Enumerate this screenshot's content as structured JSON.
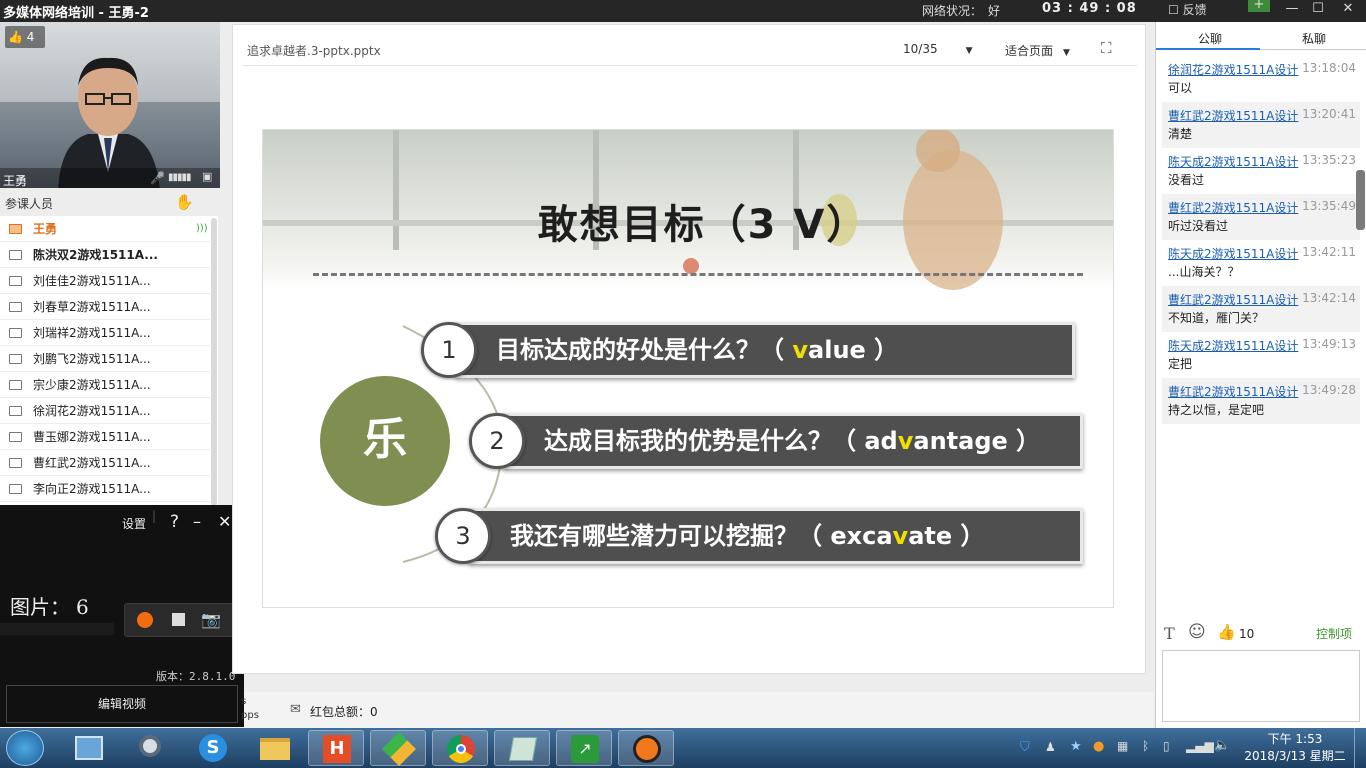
{
  "window": {
    "title": "多媒体网络培训 - 王勇-2",
    "network_label": "网络状况：",
    "network_value": "好",
    "clock": "03 : 49 : 08",
    "feedback": "反馈"
  },
  "video": {
    "likes": "4",
    "presenter": "王勇"
  },
  "roster": {
    "title": "参课人员",
    "items": [
      "王勇",
      "陈洪双2游戏1511A...",
      "刘佳佳2游戏1511A...",
      "刘春草2游戏1511A...",
      "刘瑞祥2游戏1511A...",
      "刘鹏飞2游戏1511A...",
      "宗少康2游戏1511A...",
      "徐润花2游戏1511A...",
      "曹玉娜2游戏1511A...",
      "曹红武2游戏1511A...",
      "李向正2游戏1511A..."
    ]
  },
  "recorder": {
    "settings": "设置",
    "help": "?",
    "minimize": "–",
    "close": "✕",
    "pic_label": "图片：",
    "pic_count": "6",
    "version": "版本：2.8.1.0",
    "edit_button": "编辑视频"
  },
  "document": {
    "filename": "追求卓越者.3-pptx.pptx",
    "page": "10/35",
    "fit": "适合页面"
  },
  "slide": {
    "title": "敢想目标（3 V）",
    "center": "乐",
    "items": [
      {
        "num": "1",
        "pre": "目标达成的好处是什么？（ ",
        "hl": "v",
        "post": "alue ）"
      },
      {
        "num": "2",
        "pre": "达成目标我的优势是什么？（ ad",
        "hl": "v",
        "post": "antage ）"
      },
      {
        "num": "3",
        "pre": "我还有哪些潜力可以挖掘？（ exca",
        "hl": "v",
        "post": "ate ）"
      }
    ]
  },
  "bottom": {
    "red_packet": "红包总额：0",
    "partial_text1": "s",
    "partial_text2": "pps"
  },
  "chat": {
    "tab_public": "公聊",
    "tab_private": "私聊",
    "like_count": "10",
    "control": "控制项",
    "messages": [
      {
        "user": "徐润花2游戏1511A设计",
        "time": "13:18:04",
        "text": "可以"
      },
      {
        "user": "曹红武2游戏1511A设计",
        "time": "13:20:41",
        "text": "清楚"
      },
      {
        "user": "陈天成2游戏1511A设计",
        "time": "13:35:23",
        "text": "没看过"
      },
      {
        "user": "曹红武2游戏1511A设计",
        "time": "13:35:49",
        "text": "听过没看过"
      },
      {
        "user": "陈天成2游戏1511A设计",
        "time": "13:42:11",
        "text": "...山海关？？"
      },
      {
        "user": "曹红武2游戏1511A设计",
        "time": "13:42:14",
        "text": "不知道，雁门关？"
      },
      {
        "user": "陈天成2游戏1511A设计",
        "time": "13:49:13",
        "text": "定把"
      },
      {
        "user": "曹红武2游戏1511A设计",
        "time": "13:49:28",
        "text": "持之以恒，是定吧"
      }
    ]
  },
  "taskbar": {
    "time": "下午 1:53",
    "date": "2018/3/13 星期二"
  },
  "colors": {
    "accent_green": "#7f8f51",
    "slide_pill": "#4f4f4f",
    "highlight": "#f0e000",
    "link": "#1a5fb4",
    "record_orange": "#f26b0f"
  }
}
